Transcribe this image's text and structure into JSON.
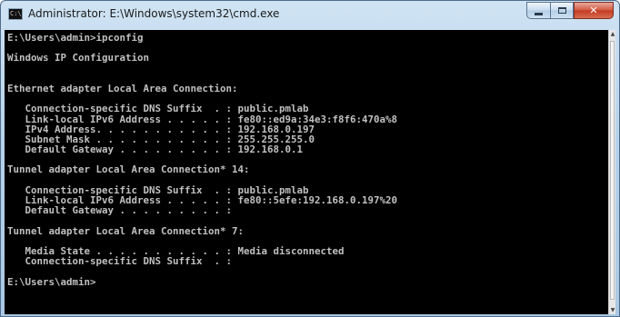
{
  "window": {
    "title": "Administrator: E:\\Windows\\system32\\cmd.exe",
    "app_icon": "cmd-icon",
    "app_icon_label": "C:\\",
    "buttons": {
      "minimize_icon": "minimize-icon",
      "maximize_icon": "maximize-icon",
      "close_icon": "close-icon",
      "close_glyph": "✕"
    }
  },
  "console": {
    "colors": {
      "background": "#000000",
      "text": "#c0c0c0"
    },
    "lines": [
      "E:\\Users\\admin>ipconfig",
      "",
      "Windows IP Configuration",
      "",
      "",
      "Ethernet adapter Local Area Connection:",
      "",
      "   Connection-specific DNS Suffix  . : public.pmlab",
      "   Link-local IPv6 Address . . . . . : fe80::ed9a:34e3:f8f6:470a%8",
      "   IPv4 Address. . . . . . . . . . . : 192.168.0.197",
      "   Subnet Mask . . . . . . . . . . . : 255.255.255.0",
      "   Default Gateway . . . . . . . . . : 192.168.0.1",
      "",
      "Tunnel adapter Local Area Connection* 14:",
      "",
      "   Connection-specific DNS Suffix  . : public.pmlab",
      "   Link-local IPv6 Address . . . . . : fe80::5efe:192.168.0.197%20",
      "   Default Gateway . . . . . . . . . :",
      "",
      "Tunnel adapter Local Area Connection* 7:",
      "",
      "   Media State . . . . . . . . . . . : Media disconnected",
      "   Connection-specific DNS Suffix  . :",
      "",
      "E:\\Users\\admin>"
    ]
  },
  "scrollbar": {
    "up_arrow": "▲",
    "down_arrow": "▼"
  }
}
